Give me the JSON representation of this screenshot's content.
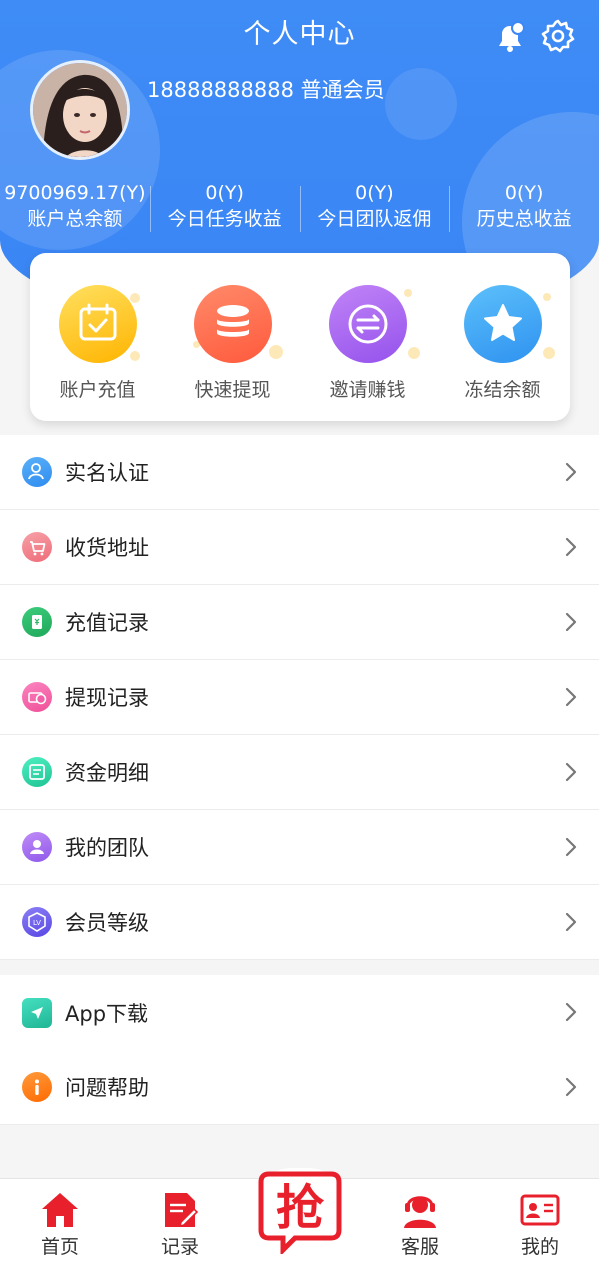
{
  "header": {
    "title": "个人中心",
    "user_line": "18888888888 普通会员"
  },
  "stats": [
    {
      "value": "9700969.17(Y)",
      "label": "账户总余额"
    },
    {
      "value": "0(Y)",
      "label": "今日任务收益"
    },
    {
      "value": "0(Y)",
      "label": "今日团队返佣"
    },
    {
      "value": "0(Y)",
      "label": "历史总收益"
    }
  ],
  "actions": [
    {
      "label": "账户充值",
      "icon": "calendar-check-icon",
      "color": "#ffc21a"
    },
    {
      "label": "快速提现",
      "icon": "coin-stack-icon",
      "color": "#ff6d4f"
    },
    {
      "label": "邀请赚钱",
      "icon": "exchange-icon",
      "color": "#a663ef"
    },
    {
      "label": "冻结余额",
      "icon": "star-icon",
      "color": "#3aa3f5"
    }
  ],
  "menu1": [
    {
      "label": "实名认证",
      "icon": "user-verify-icon",
      "color": "#3b9bf0"
    },
    {
      "label": "收货地址",
      "icon": "cart-icon",
      "color": "#f06f7a"
    },
    {
      "label": "充值记录",
      "icon": "wallet-icon",
      "color": "#2cb566"
    },
    {
      "label": "提现记录",
      "icon": "money-icon",
      "color": "#f25fa6"
    },
    {
      "label": "资金明细",
      "icon": "ledger-icon",
      "color": "#29d2a2"
    },
    {
      "label": "我的团队",
      "icon": "team-icon",
      "color": "#a46bf0"
    },
    {
      "label": "会员等级",
      "icon": "level-badge-icon",
      "color": "#6c5ef0"
    }
  ],
  "menu2": [
    {
      "label": "App下载",
      "icon": "send-icon",
      "color": "#2bc8a8"
    },
    {
      "label": "问题帮助",
      "icon": "info-icon",
      "color": "#ff7a1a"
    }
  ],
  "tabs": [
    {
      "label": "首页",
      "icon": "home-icon"
    },
    {
      "label": "记录",
      "icon": "record-icon"
    },
    {
      "label": "",
      "icon": "grab-icon"
    },
    {
      "label": "客服",
      "icon": "customer-service-icon"
    },
    {
      "label": "我的",
      "icon": "profile-card-icon"
    }
  ],
  "colors": {
    "brand_blue": "#3b87f5",
    "tab_red": "#e8202c"
  }
}
